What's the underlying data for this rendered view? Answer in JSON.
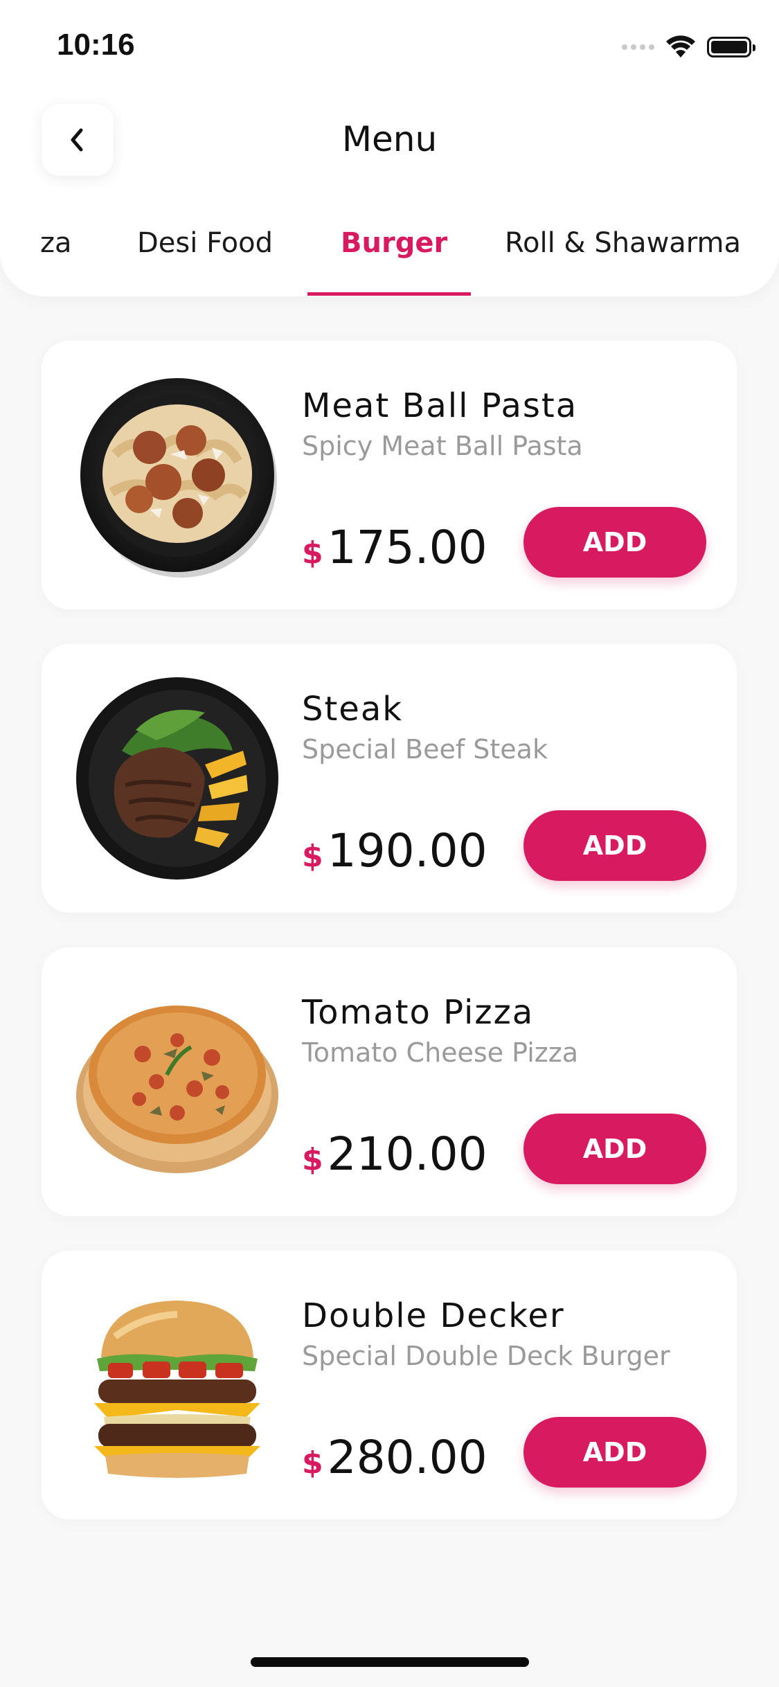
{
  "status": {
    "time": "10:16"
  },
  "header": {
    "title": "Menu"
  },
  "tabs": [
    {
      "label": "za"
    },
    {
      "label": "Desi Food"
    },
    {
      "label": "Burger"
    },
    {
      "label": "Roll & Shawarma"
    }
  ],
  "active_tab": "Burger",
  "items": [
    {
      "name": "Meat Ball Pasta",
      "description": "Spicy Meat Ball Pasta",
      "currency": "$",
      "price": "175.00",
      "button": "ADD"
    },
    {
      "name": "Steak",
      "description": "Special Beef Steak",
      "currency": "$",
      "price": "190.00",
      "button": "ADD"
    },
    {
      "name": "Tomato Pizza",
      "description": "Tomato Cheese Pizza",
      "currency": "$",
      "price": "210.00",
      "button": "ADD"
    },
    {
      "name": "Double Decker",
      "description": "Special Double Deck Burger",
      "currency": "$",
      "price": "280.00",
      "button": "ADD"
    }
  ],
  "colors": {
    "accent": "#d81b60",
    "background": "#f8f8f8",
    "muted_text": "#9a9a9a"
  },
  "icons": {
    "back": "chevron-left-icon",
    "wifi": "wifi-icon",
    "battery": "battery-icon",
    "signal": "cellular-signal-icon"
  }
}
